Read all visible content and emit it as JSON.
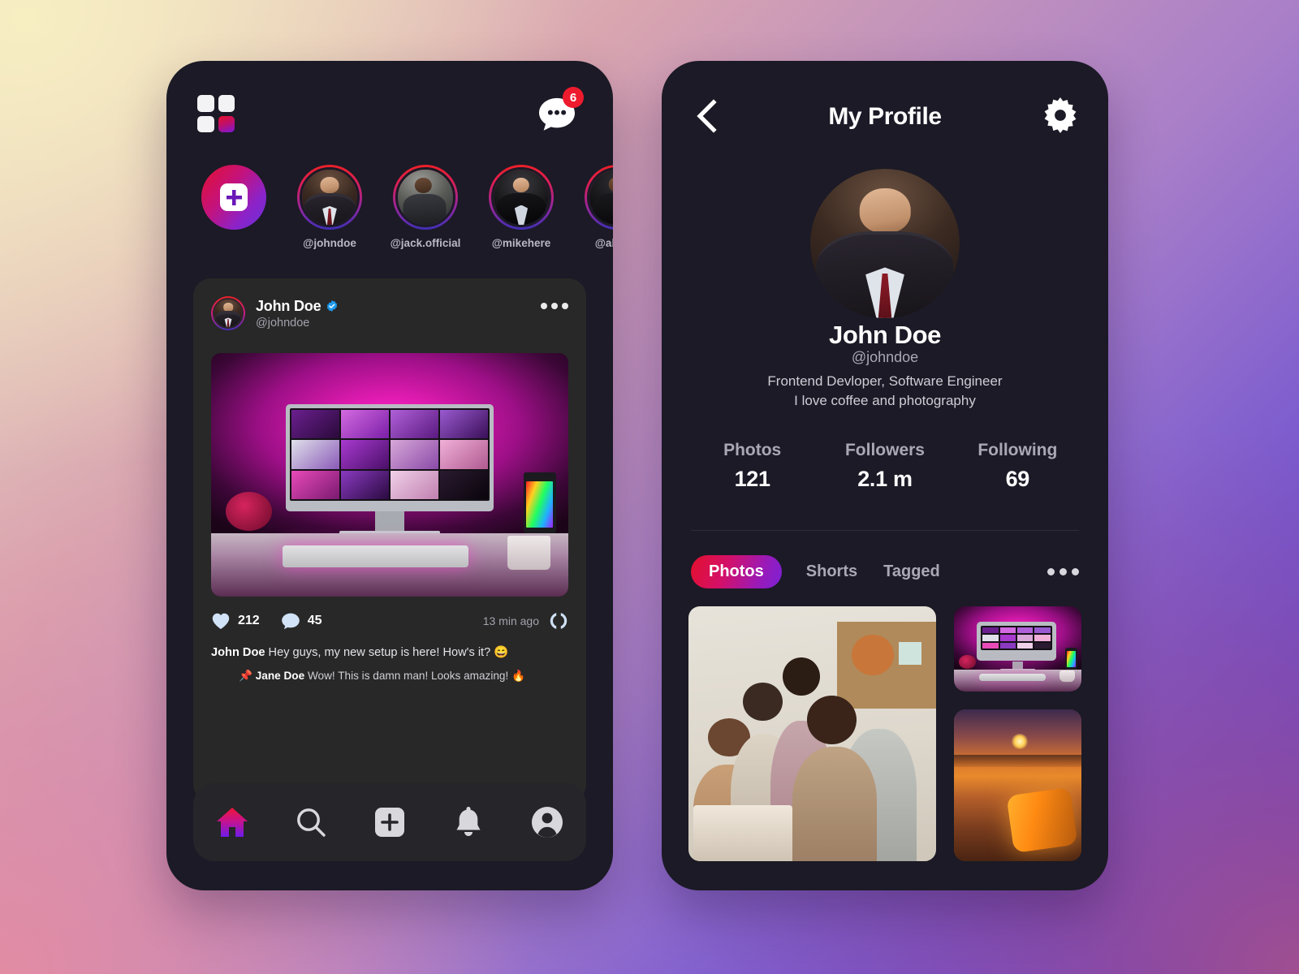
{
  "background": {
    "accent_pink": "#e3102c",
    "accent_purple": "#7a22d6",
    "badge_red": "#ee1b2e"
  },
  "left_phone": {
    "top_bar": {
      "logo_icon": "grid-apps-icon",
      "messages_icon": "chat-bubble-icon",
      "messages_badge": "6"
    },
    "stories": {
      "add_story_icon": "plus-icon",
      "items": [
        {
          "handle": "@johndoe",
          "avatar": "man-suit-portrait"
        },
        {
          "handle": "@jack.official",
          "avatar": "man-suit-outdoors"
        },
        {
          "handle": "@mikehere",
          "avatar": "man-tuxedo-dark"
        },
        {
          "handle": "@alex.ly",
          "avatar": "man-suit-glasses"
        }
      ]
    },
    "post": {
      "author_name": "John Doe",
      "author_handle": "@johndoe",
      "verified_icon": "verified-badge-icon",
      "more_icon": "more-horizontal-icon",
      "image_alt": "pink-lit-imac-desk-setup",
      "like_icon": "heart-icon",
      "likes": "212",
      "comment_icon": "comment-bubble-icon",
      "comments": "45",
      "timestamp": "13 min ago",
      "share_icon": "share-loop-icon",
      "caption_author": "John Doe",
      "caption_text": " Hey guys, my new setup is here! How's it? 😄",
      "reply_pin_icon": "pin-icon",
      "reply_author": "Jane Doe",
      "reply_text": " Wow! This is damn man! Looks amazing! 🔥"
    },
    "bottom_nav": [
      {
        "name": "home",
        "icon": "home-icon",
        "active": true
      },
      {
        "name": "search",
        "icon": "search-icon",
        "active": false
      },
      {
        "name": "create",
        "icon": "plus-square-icon",
        "active": false
      },
      {
        "name": "notifications",
        "icon": "bell-icon",
        "active": false
      },
      {
        "name": "profile",
        "icon": "user-circle-icon",
        "active": false
      }
    ]
  },
  "right_phone": {
    "header": {
      "back_icon": "chevron-left-icon",
      "title": "My Profile",
      "settings_icon": "gear-icon"
    },
    "profile": {
      "avatar_alt": "man-suit-portrait",
      "name": "John Doe",
      "handle": "@johndoe",
      "bio_line_1": "Frontend Devloper, Software Engineer",
      "bio_line_2": "I love coffee and photography"
    },
    "stats": [
      {
        "label": "Photos",
        "value": "121"
      },
      {
        "label": "Followers",
        "value": "2.1 m"
      },
      {
        "label": "Following",
        "value": "69"
      }
    ],
    "tabs": {
      "items": [
        {
          "label": "Photos",
          "active": true
        },
        {
          "label": "Shorts",
          "active": false
        },
        {
          "label": "Tagged",
          "active": false
        }
      ],
      "more_icon": "more-horizontal-icon"
    },
    "gallery": [
      {
        "alt": "team-looking-at-laptop",
        "position": "large-left"
      },
      {
        "alt": "pink-lit-imac-desk-setup",
        "position": "top-right"
      },
      {
        "alt": "sunset-beach-bottle",
        "position": "bottom-right"
      }
    ]
  }
}
